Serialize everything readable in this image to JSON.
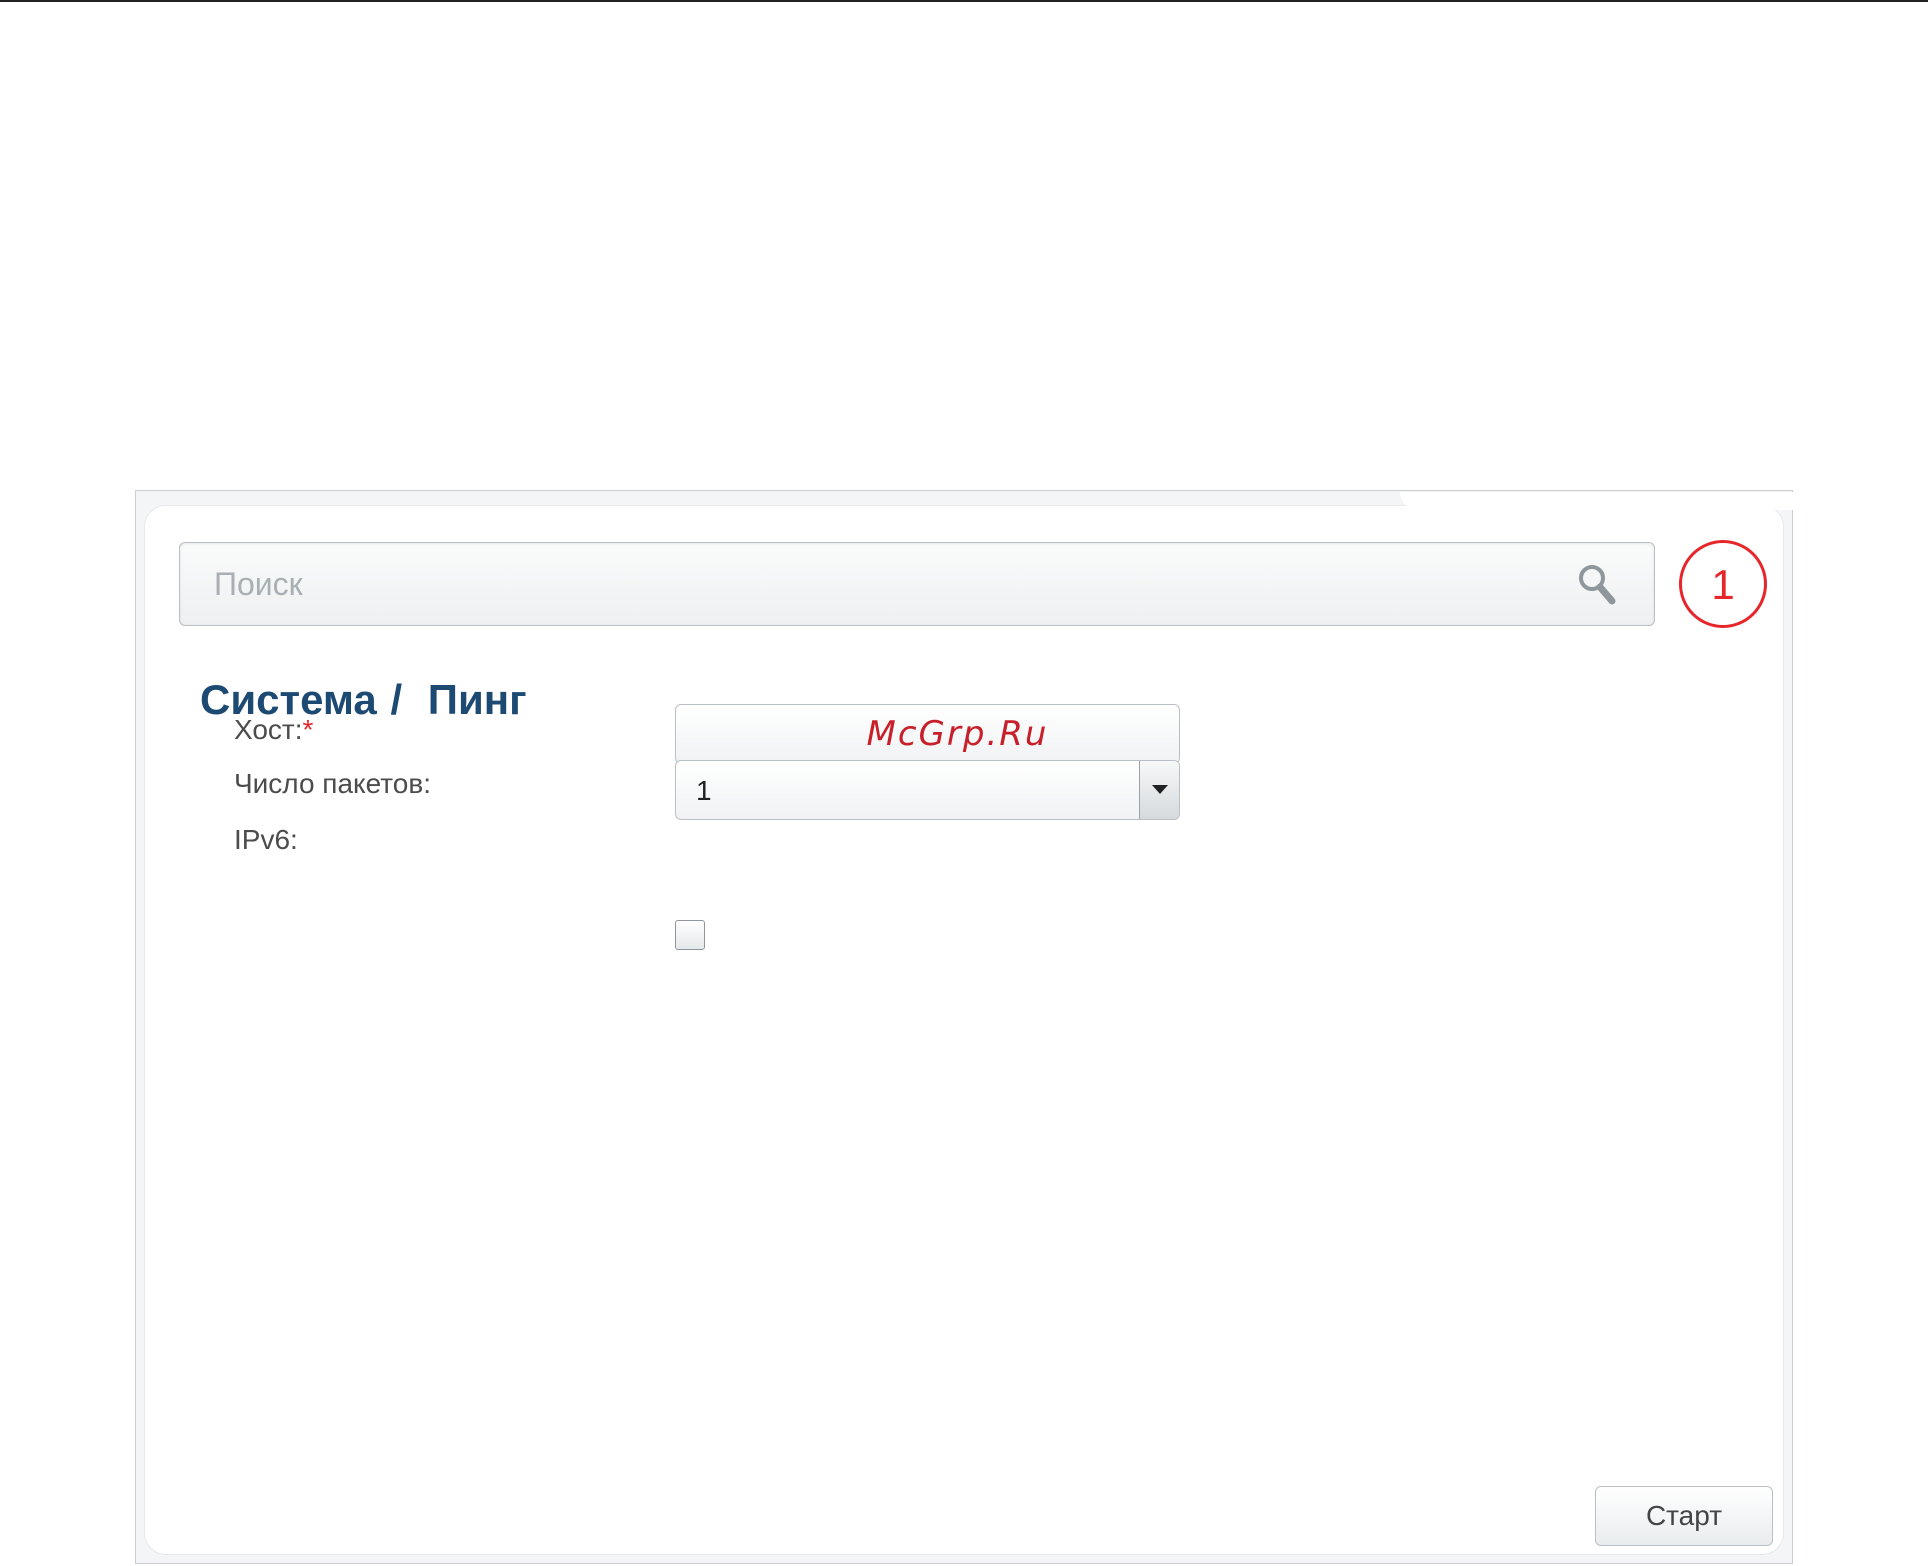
{
  "search": {
    "placeholder": "Поиск"
  },
  "notifications": {
    "count": "1"
  },
  "breadcrumb": {
    "section": "Система",
    "separator": "/",
    "page": "Пинг"
  },
  "form": {
    "host": {
      "label": "Хост:",
      "required_mark": "*",
      "value": "McGrp.Ru"
    },
    "packets": {
      "label": "Число пакетов:",
      "value": "1"
    },
    "ipv6": {
      "label": "IPv6:",
      "checked": false
    }
  },
  "actions": {
    "start_label": "Старт"
  },
  "colors": {
    "title": "#1d4a73",
    "accent_red": "#e6262b",
    "border": "#b9c0c5"
  },
  "icons": {
    "search": "search-icon",
    "dropdown": "chevron-down-icon"
  }
}
